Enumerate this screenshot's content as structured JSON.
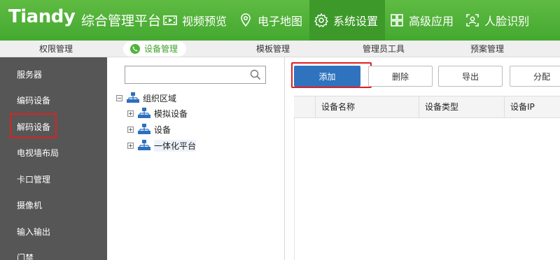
{
  "header": {
    "logo": "Tiandy",
    "app_title": "综合管理平台",
    "nav": [
      {
        "label": "视频预览",
        "icon": "film-icon"
      },
      {
        "label": "电子地图",
        "icon": "map-pin-icon"
      },
      {
        "label": "系统设置",
        "icon": "gear-icon",
        "active": true
      },
      {
        "label": "高级应用",
        "icon": "grid-icon"
      },
      {
        "label": "人脸识别",
        "icon": "face-id-icon"
      }
    ]
  },
  "subtabs": [
    {
      "label": "权限管理"
    },
    {
      "label": "设备管理",
      "active": true
    },
    {
      "label": "模板管理"
    },
    {
      "label": "管理员工具"
    },
    {
      "label": "预案管理"
    }
  ],
  "sidebar": {
    "items": [
      {
        "label": "服务器"
      },
      {
        "label": "编码设备"
      },
      {
        "label": "解码设备",
        "active": true
      },
      {
        "label": "电视墙布局"
      },
      {
        "label": "卡口管理"
      },
      {
        "label": "摄像机"
      },
      {
        "label": "输入输出"
      },
      {
        "label": "门禁"
      }
    ]
  },
  "tree": {
    "search_placeholder": "",
    "root": {
      "label": "组织区域",
      "expander": "−"
    },
    "children": [
      {
        "label": "模拟设备",
        "expander": "+"
      },
      {
        "label": "设备",
        "expander": "+"
      },
      {
        "label": "一体化平台",
        "expander": "+"
      }
    ]
  },
  "toolbar": {
    "add": "添加",
    "delete": "删除",
    "export": "导出",
    "assign": "分配"
  },
  "table": {
    "columns": [
      "设备名称",
      "设备类型",
      "设备IP"
    ]
  },
  "colors": {
    "header_green": "#4cae36",
    "active_nav": "#3d9a2a",
    "sidebar_bg": "#565656",
    "primary_button": "#2f73bf",
    "highlight_red": "#e02020"
  }
}
